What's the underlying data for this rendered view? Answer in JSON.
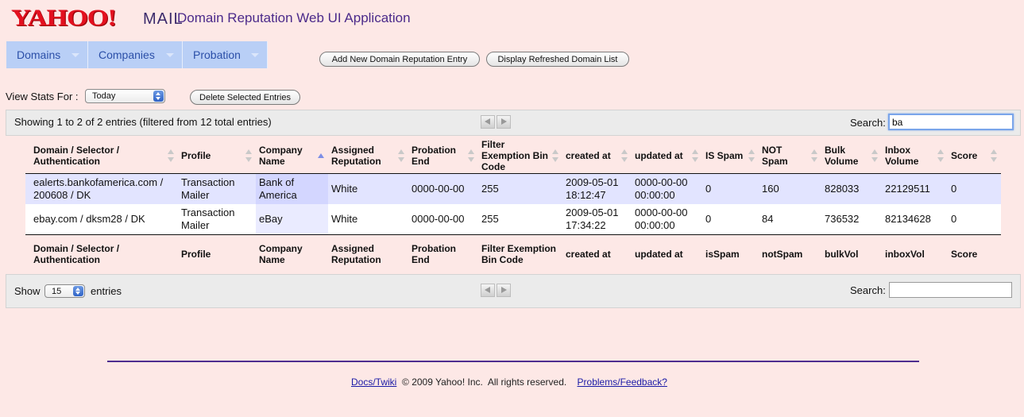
{
  "header": {
    "logo_text": "YAHOO!",
    "logo_mail": "MAIL",
    "app_title": "Domain Reputation Web UI Application"
  },
  "nav": {
    "items": [
      {
        "label": "Domains"
      },
      {
        "label": "Companies"
      },
      {
        "label": "Probation"
      }
    ]
  },
  "actions": {
    "add_entry": "Add New Domain Reputation Entry",
    "refresh_list": "Display Refreshed Domain List",
    "delete_selected": "Delete Selected Entries"
  },
  "view_stats": {
    "label": "View Stats For :",
    "selected": "Today"
  },
  "table_top": {
    "info": "Showing 1 to 2 of 2 entries (filtered from 12 total entries)",
    "search_label": "Search:",
    "search_value": "ba"
  },
  "table": {
    "header": [
      "Domain / Selector / Authentication",
      "Profile",
      "Company Name",
      "Assigned Reputation",
      "Probation End",
      "Filter Exemption Bin Code",
      "created at",
      "updated at",
      "IS Spam",
      "NOT Spam",
      "Bulk Volume",
      "Inbox Volume",
      "Score"
    ],
    "footer": [
      "Domain / Selector / Authentication",
      "Profile",
      "Company Name",
      "Assigned Reputation",
      "Probation End",
      "Filter Exemption Bin Code",
      "created at",
      "updated at",
      "isSpam",
      "notSpam",
      "bulkVol",
      "inboxVol",
      "Score"
    ],
    "rows": [
      {
        "domain": "ealerts.bankofamerica.com / 200608 / DK",
        "profile": "Transaction Mailer",
        "company": "Bank of America",
        "reputation": "White",
        "probation_end": "0000-00-00",
        "bin_code": "255",
        "created_at": "2009-05-01 18:12:47",
        "updated_at": "0000-00-00 00:00:00",
        "is_spam": "0",
        "not_spam": "160",
        "bulk_volume": "828033",
        "inbox_volume": "22129511",
        "score": "0"
      },
      {
        "domain": "ebay.com / dksm28 / DK",
        "profile": "Transaction Mailer",
        "company": "eBay",
        "reputation": "White",
        "probation_end": "0000-00-00",
        "bin_code": "255",
        "created_at": "2009-05-01 17:34:22",
        "updated_at": "0000-00-00 00:00:00",
        "is_spam": "0",
        "not_spam": "84",
        "bulk_volume": "736532",
        "inbox_volume": "82134628",
        "score": "0"
      }
    ]
  },
  "table_bottom": {
    "show_label": "Show",
    "entries_value": "15",
    "entries_label": "entries",
    "search_label": "Search:",
    "search_value": ""
  },
  "footer": {
    "docs_link": "Docs/Twiki",
    "copyright": "© 2009 Yahoo! Inc.  All rights reserved.",
    "feedback_link": "Problems/Feedback?"
  },
  "colors": {
    "background": "#fde8e6",
    "nav_bg": "#b9cff6",
    "accent_purple": "#4b2a8a",
    "logo_red": "#e3101f",
    "row_highlight": "#e2e4ff"
  }
}
